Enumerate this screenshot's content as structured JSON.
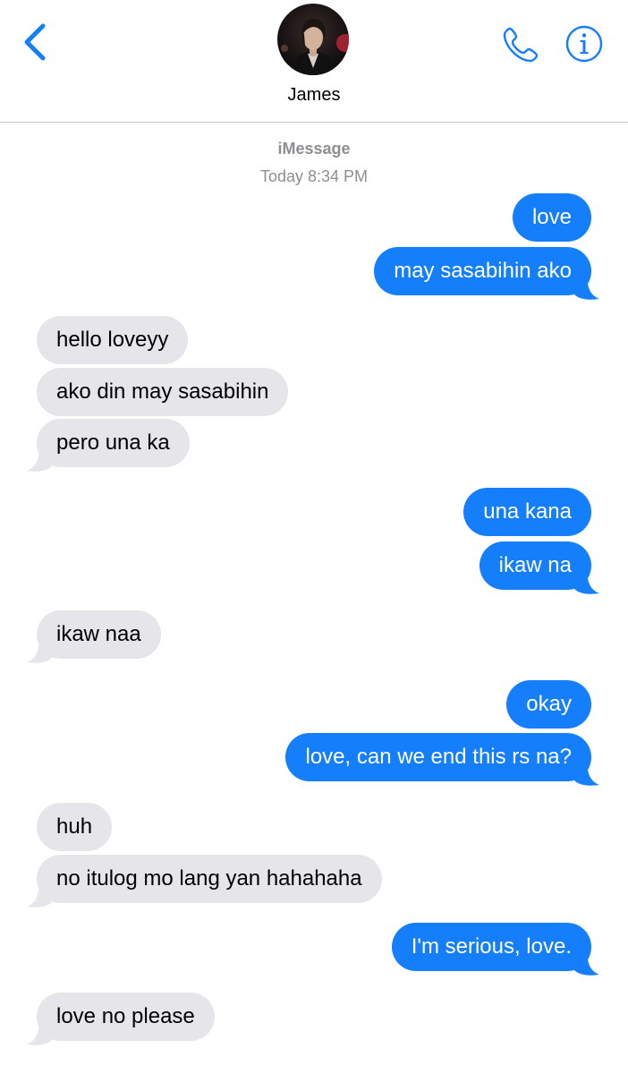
{
  "header": {
    "contact_name": "James",
    "back_icon": "chevron-left-icon",
    "call_icon": "phone-icon",
    "info_icon": "info-icon",
    "accent_color": "#147efb"
  },
  "thread_meta": {
    "service": "iMessage",
    "timestamp": "Today 8:34 PM"
  },
  "colors": {
    "sent_bubble": "#147efb",
    "received_bubble": "#e5e5ea",
    "meta_text": "#8e8e93"
  },
  "messages": [
    {
      "from": "me",
      "text": "love"
    },
    {
      "from": "me",
      "text": "may sasabihin ako"
    },
    {
      "from": "them",
      "text": "hello loveyy"
    },
    {
      "from": "them",
      "text": "ako din may sasabihin"
    },
    {
      "from": "them",
      "text": "pero una ka"
    },
    {
      "from": "me",
      "text": "una kana"
    },
    {
      "from": "me",
      "text": "ikaw na"
    },
    {
      "from": "them",
      "text": "ikaw naa"
    },
    {
      "from": "me",
      "text": "okay"
    },
    {
      "from": "me",
      "text": "love,  can we end this rs na?"
    },
    {
      "from": "them",
      "text": "huh"
    },
    {
      "from": "them",
      "text": "no itulog mo lang yan hahahaha"
    },
    {
      "from": "me",
      "text": "I'm serious, love."
    },
    {
      "from": "them",
      "text": "love no please"
    }
  ]
}
